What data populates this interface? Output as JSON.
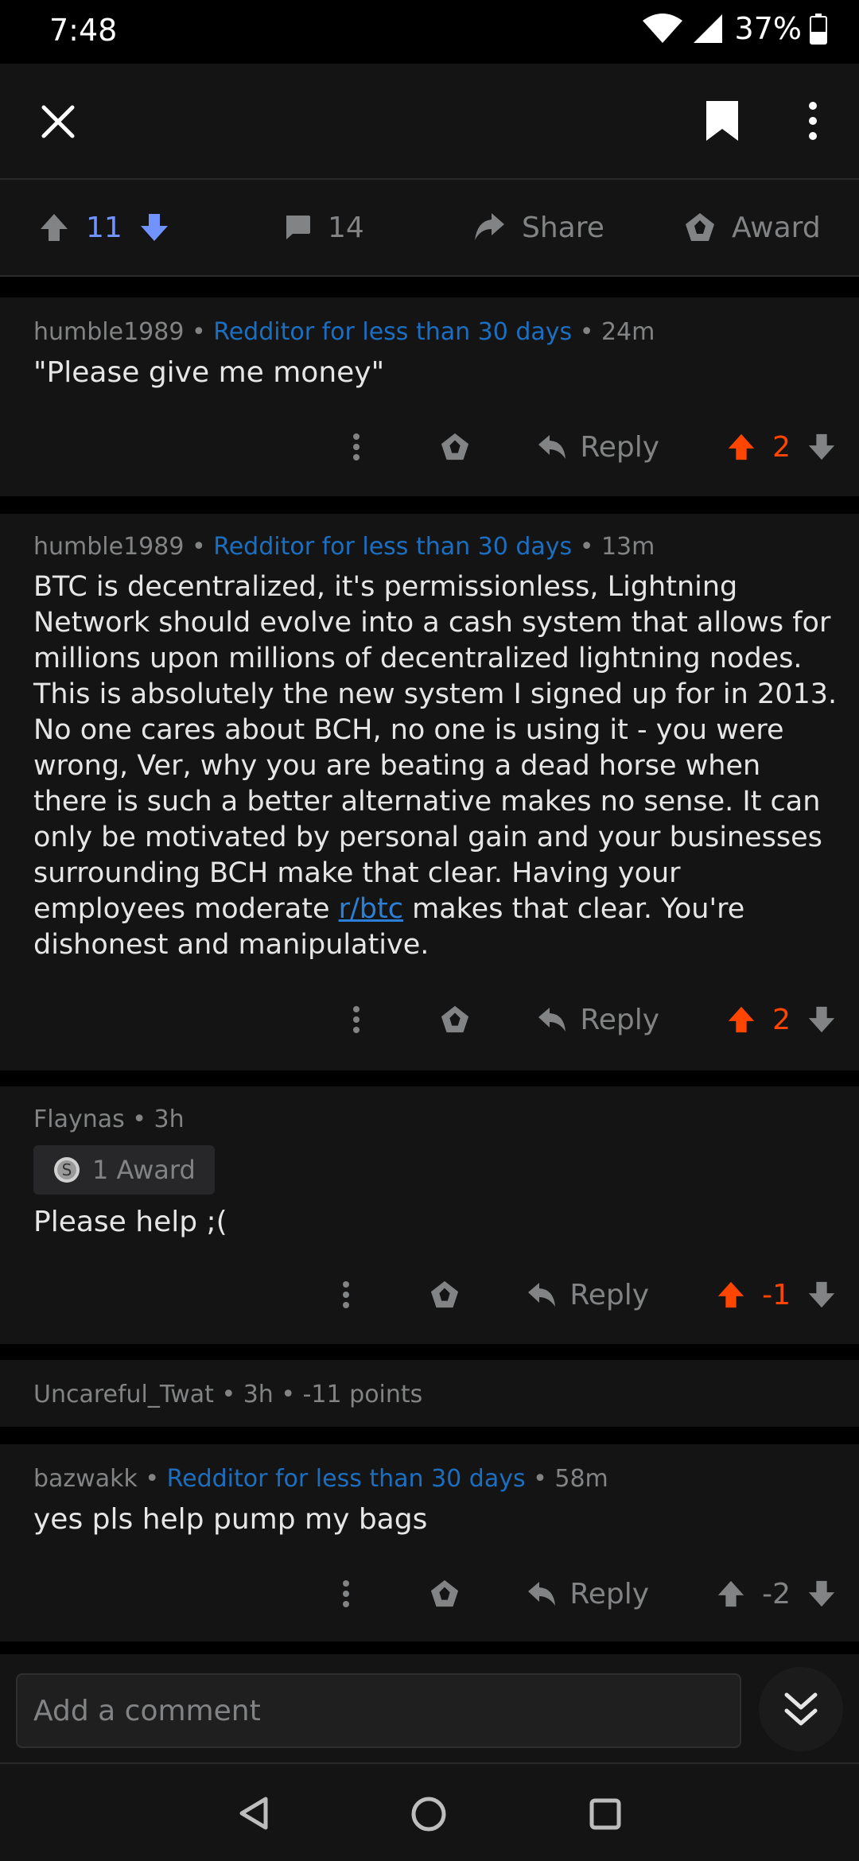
{
  "status_bar": {
    "time": "7:48",
    "battery": "37%"
  },
  "post_actions": {
    "score": "11",
    "comments": "14",
    "share": "Share",
    "award": "Award"
  },
  "comments": [
    {
      "author": "humble1989",
      "flair": "Redditor for less than 30 days",
      "age": "24m",
      "body": "\"Please give me money\"",
      "reply": "Reply",
      "score": "2"
    },
    {
      "author": "humble1989",
      "flair": "Redditor for less than 30 days",
      "age": "13m",
      "body_before": "BTC is decentralized, it's permissionless, Lightning Network should evolve into a cash system that allows for millions upon millions of decentralized lightning nodes. This is absolutely the new system I signed up for in 2013. No one cares about BCH, no one is using it - you were wrong, Ver, why you are beating a dead horse when there is such a better alternative makes no sense. It can only be motivated by personal gain and your businesses surrounding BCH make that clear. Having your employees moderate ",
      "link": "r/btc",
      "body_after": " makes that clear. You're dishonest and manipulative.",
      "reply": "Reply",
      "score": "2"
    },
    {
      "author": "Flaynas",
      "age": "3h",
      "award_chip": "1 Award",
      "body": "Please help ;(",
      "reply": "Reply",
      "score": "-1"
    },
    {
      "author": "Uncareful_Twat",
      "age": "3h",
      "points": "-11 points"
    },
    {
      "author": "bazwakk",
      "flair": "Redditor for less than 30 days",
      "age": "58m",
      "body": "yes pls help pump my bags",
      "reply": "Reply",
      "score": "-2"
    }
  ],
  "composer": {
    "placeholder": "Add a comment"
  },
  "colors": {
    "upvote": "#ff4500",
    "downvote_active": "#7193ff",
    "flair": "#1c6fc0",
    "background": "#141414"
  },
  "icons": [
    "close-icon",
    "bookmark-icon",
    "overflow-menu-icon",
    "upvote-arrow-icon",
    "downvote-arrow-icon",
    "comment-bubble-icon",
    "share-arrow-icon",
    "award-icon",
    "reply-arrow-icon",
    "double-chevron-down-icon",
    "back-triangle-icon",
    "home-circle-icon",
    "recents-square-icon"
  ]
}
